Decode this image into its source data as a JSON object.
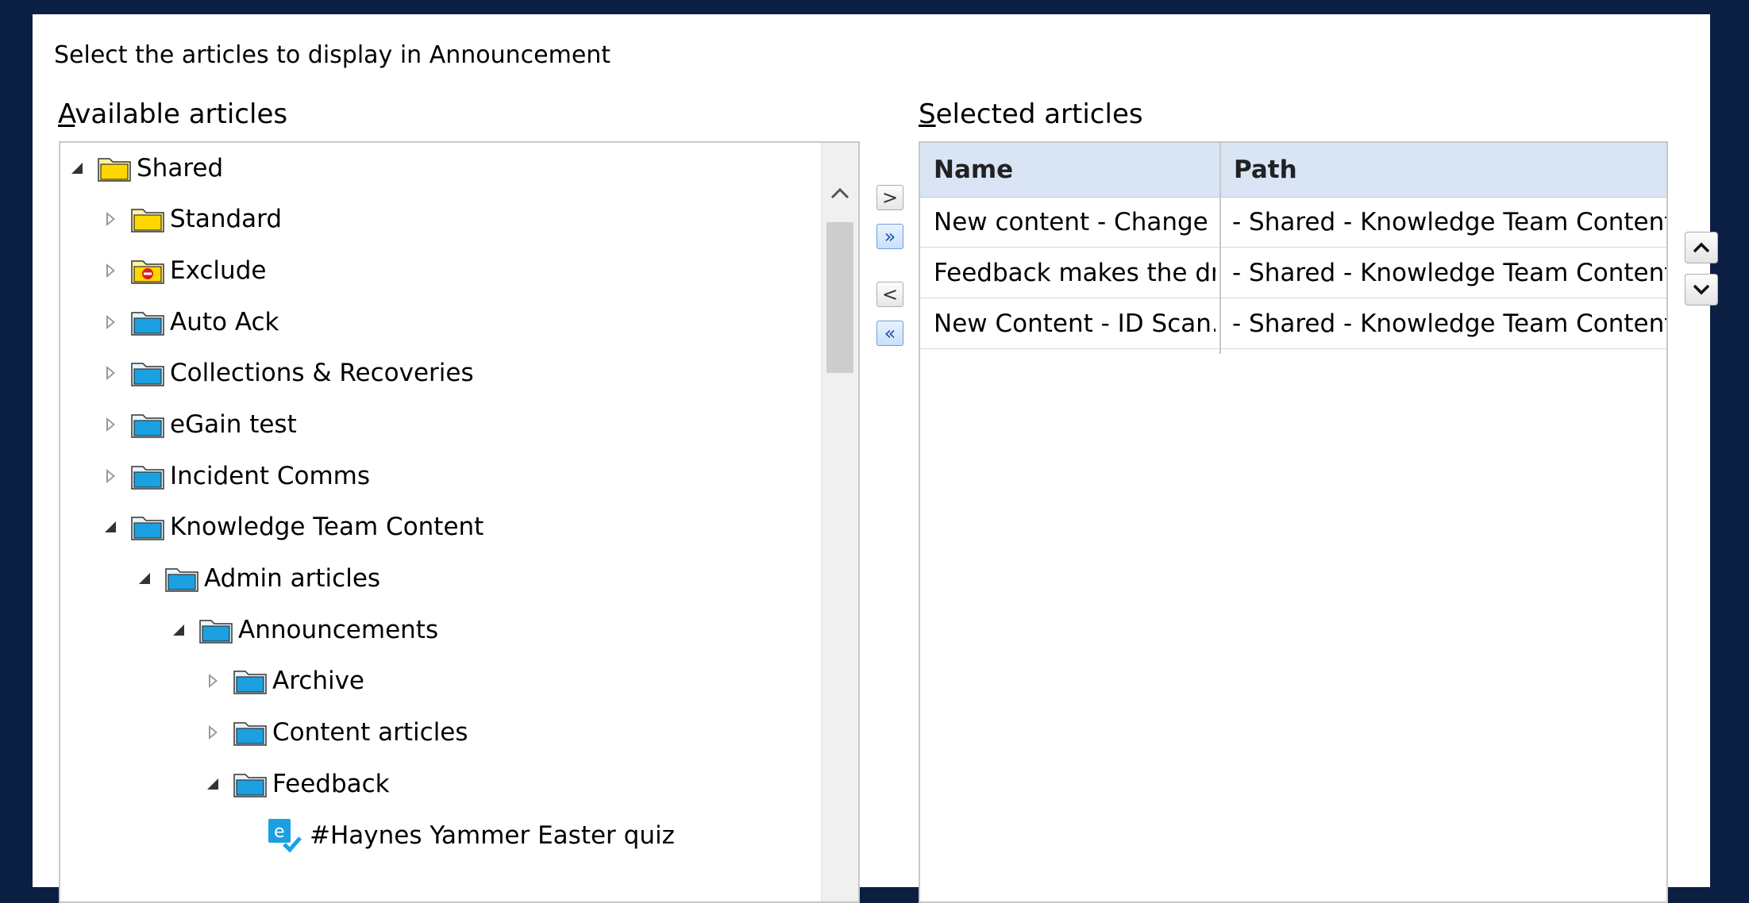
{
  "dialog": {
    "instruction": "Select the articles to display in Announcement",
    "available_label_accel": "A",
    "available_label_rest": "vailable articles",
    "selected_label_accel": "S",
    "selected_label_rest": "elected articles"
  },
  "tree": {
    "items": [
      {
        "label": "Shared",
        "state": "open",
        "icon": "yellow-folder-icon"
      },
      {
        "label": "Standard",
        "state": "closed",
        "icon": "yellow-folder-icon"
      },
      {
        "label": "Exclude",
        "state": "closed",
        "icon": "excluded-folder-icon"
      },
      {
        "label": "Auto Ack",
        "state": "closed",
        "icon": "blue-folder-icon"
      },
      {
        "label": "Collections & Recoveries",
        "state": "closed",
        "icon": "blue-folder-icon"
      },
      {
        "label": "eGain test",
        "state": "closed",
        "icon": "blue-folder-icon"
      },
      {
        "label": "Incident Comms",
        "state": "closed",
        "icon": "blue-folder-icon"
      },
      {
        "label": "Knowledge Team Content",
        "state": "open",
        "icon": "blue-folder-icon"
      },
      {
        "label": "Admin articles",
        "state": "open",
        "icon": "blue-folder-icon"
      },
      {
        "label": "Announcements",
        "state": "open",
        "icon": "blue-folder-icon"
      },
      {
        "label": "Archive",
        "state": "closed",
        "icon": "blue-folder-icon"
      },
      {
        "label": "Content articles",
        "state": "closed",
        "icon": "blue-folder-icon"
      },
      {
        "label": "Feedback",
        "state": "open",
        "icon": "blue-folder-icon"
      },
      {
        "label": "#Haynes Yammer Easter quiz",
        "state": "leaf",
        "icon": "published-article-icon"
      }
    ]
  },
  "transfer_buttons": {
    "add": ">",
    "add_all": "»",
    "remove": "<",
    "remove_all": "«"
  },
  "grid": {
    "columns": [
      "Name",
      "Path"
    ],
    "rows": [
      {
        "name": "New content - Change ...",
        "path": "- Shared - Knowledge Team Content..."
      },
      {
        "name": "Feedback makes the dr...",
        "path": "- Shared - Knowledge Team Content..."
      },
      {
        "name": "New Content - ID Scan...",
        "path": "- Shared - Knowledge Team Content..."
      }
    ]
  },
  "colors": {
    "background": "#0b1f42",
    "header": "#d9e5f5",
    "blue_folder": "#1ba1e2",
    "yellow_folder": "#ffd700"
  }
}
